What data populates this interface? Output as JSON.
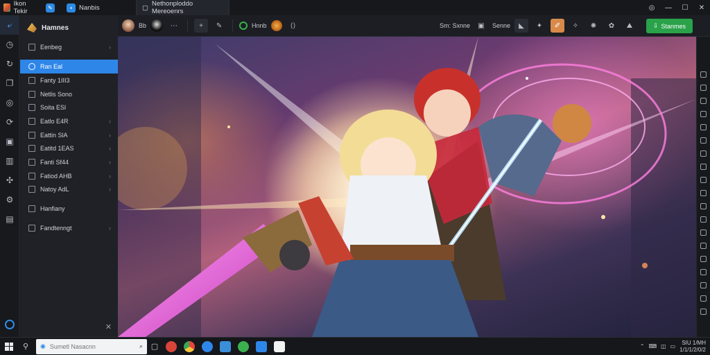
{
  "window": {
    "tab1_label": "Ikon Tekir",
    "tab3_label": "Nanbis",
    "tab4_label": "Nethonploddo Mereoenrs",
    "controls": [
      "◎",
      "—",
      "☐",
      "✕"
    ]
  },
  "rail": {
    "icons": [
      "arrow-icon",
      "clock-icon",
      "refresh-icon",
      "layers-icon",
      "camera-icon",
      "globe-icon",
      "image-icon",
      "chart-icon",
      "puzzle-icon",
      "settings-icon",
      "box-icon"
    ]
  },
  "sidebar": {
    "header": "Hamnes",
    "items": [
      {
        "label": "Eenbeg",
        "chevron": true
      },
      {
        "label": "Ran Eal",
        "selected": true
      },
      {
        "label": "Fanty 1III3"
      },
      {
        "label": "Netlis Sono"
      },
      {
        "label": "Soita ESl"
      },
      {
        "label": "Eatlo E4R",
        "chevron": true
      },
      {
        "label": "Eattin SlA",
        "chevron": true
      },
      {
        "label": "Eatitd 1EAS",
        "chevron": true
      },
      {
        "label": "Fanti Sf44",
        "chevron": true
      },
      {
        "label": "Fatiod AHB",
        "chevron": true
      },
      {
        "label": "Natoy AdL",
        "chevron": true
      },
      {
        "label": "Hanfiany"
      },
      {
        "label": "Fandtenngt",
        "chevron": true
      }
    ],
    "close_label": "✕"
  },
  "toolbar": {
    "text1": "Bb",
    "text2": "Hnnb",
    "status_text1": "Sm: Sxnne",
    "status_text2": "Senne",
    "primary_label": "Stanmes"
  },
  "taskbar": {
    "search_placeholder": "Sumetl Nasacnn",
    "clock_time": "SIU 1/MH",
    "clock_date": "1/1/1/2/0/2"
  },
  "colors": {
    "accent": "#2e86e8",
    "primary_button": "#2aa24a",
    "active_tool": "#d98a4a"
  }
}
